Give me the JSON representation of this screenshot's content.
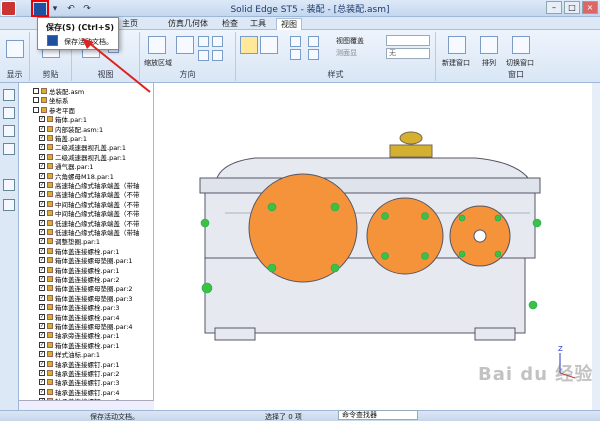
{
  "window": {
    "title": "Solid Edge ST5 - 装配 - [总装配.asm]"
  },
  "menu_tabs": [
    "主页",
    "",
    "仿真几何体",
    "检查",
    "工具",
    "视图"
  ],
  "popup": {
    "title": "保存(S) (Ctrl+S)",
    "description": "保存活动文档。"
  },
  "ribbon": {
    "groups": [
      "显示",
      "剪贴",
      "视图",
      "方向",
      "样式",
      "窗口"
    ],
    "labels": [
      "缩放区域",
      "视图覆盖",
      "测面显",
      "无",
      "新建窗口",
      "排列",
      "切换窗口"
    ]
  },
  "tree": {
    "items": [
      {
        "label": "总装配.asm",
        "checked": false
      },
      {
        "label": "坐标系",
        "checked": false
      },
      {
        "label": "参考平面",
        "checked": false
      },
      {
        "label": "箱体.par:1",
        "checked": true
      },
      {
        "label": "内部装配.asm:1",
        "checked": true
      },
      {
        "label": "箱盖.par:1",
        "checked": true
      },
      {
        "label": "二级减速器视孔盖.par:1",
        "checked": true
      },
      {
        "label": "二级减速器视孔盖.par:1",
        "checked": true
      },
      {
        "label": "通气器.par:1",
        "checked": true
      },
      {
        "label": "六角螺母M18.par:1",
        "checked": true
      },
      {
        "label": "高速轴凸缘式轴承端盖（带轴",
        "checked": true
      },
      {
        "label": "高速轴凸缘式轴承端盖（不带",
        "checked": true
      },
      {
        "label": "中间轴凸缘式轴承端盖（不带",
        "checked": true
      },
      {
        "label": "中间轴凸缘式轴承端盖（不带",
        "checked": true
      },
      {
        "label": "低速轴凸缘式轴承端盖（不带",
        "checked": true
      },
      {
        "label": "低速轴凸缘式轴承端盖（带轴",
        "checked": true
      },
      {
        "label": "调整垫圈.par:1",
        "checked": true
      },
      {
        "label": "箱体盖连接螺栓.par:1",
        "checked": true
      },
      {
        "label": "箱体盖连接螺母垫圈.par:1",
        "checked": true
      },
      {
        "label": "箱体盖连接螺栓.par:1",
        "checked": true
      },
      {
        "label": "箱体盖连接螺栓.par:2",
        "checked": true
      },
      {
        "label": "箱体盖连接螺母垫圈.par:2",
        "checked": true
      },
      {
        "label": "箱体盖连接螺母垫圈.par:3",
        "checked": true
      },
      {
        "label": "箱体盖连接螺栓.par:3",
        "checked": true
      },
      {
        "label": "箱体盖连接螺栓.par:4",
        "checked": true
      },
      {
        "label": "箱体盖连接螺母垫圈.par:4",
        "checked": true
      },
      {
        "label": "轴承旁连接螺栓.par:1",
        "checked": true
      },
      {
        "label": "箱体盖连接螺栓.par:1",
        "checked": true
      },
      {
        "label": "样式油标.par:1",
        "checked": true
      },
      {
        "label": "轴承盖连接螺钉.par:1",
        "checked": true
      },
      {
        "label": "轴承盖连接螺钉.par:2",
        "checked": true
      },
      {
        "label": "轴承盖连接螺钉.par:3",
        "checked": true
      },
      {
        "label": "轴承盖连接螺钉.par:4",
        "checked": true
      },
      {
        "label": "轴承盖连接螺钉.par:5",
        "checked": true
      }
    ]
  },
  "status": {
    "left": "保存活动文档。",
    "selection": "选择了 0 项",
    "command_finder": "命令查找器"
  },
  "watermark": "Bai du 经验",
  "colors": {
    "accent": "#1f4f9f",
    "gear": "#f5933a",
    "body": "#e6eaf0",
    "bolt": "#3fc040",
    "cap": "#d4b030"
  }
}
